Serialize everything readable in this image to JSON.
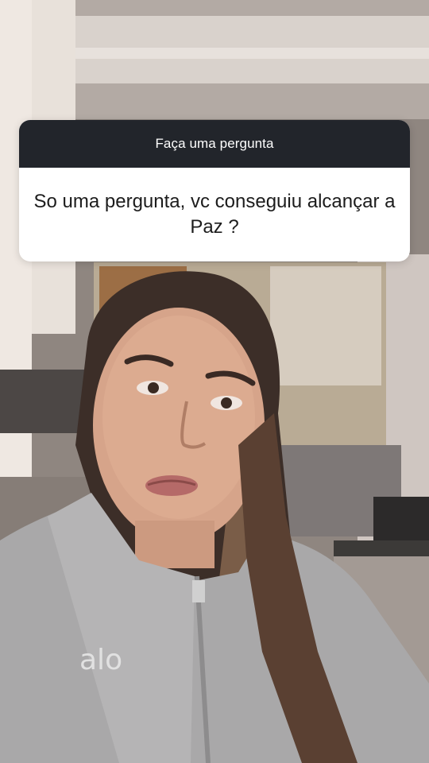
{
  "question_box": {
    "header": "Faça uma pergunta",
    "question": "So uma pergunta, vc conseguiu alcançar a Paz ?"
  },
  "photo": {
    "logo_text": "alo"
  },
  "colors": {
    "header_bg": "#22252b",
    "card_bg": "#ffffff",
    "text_dark": "#1c1c1c"
  }
}
